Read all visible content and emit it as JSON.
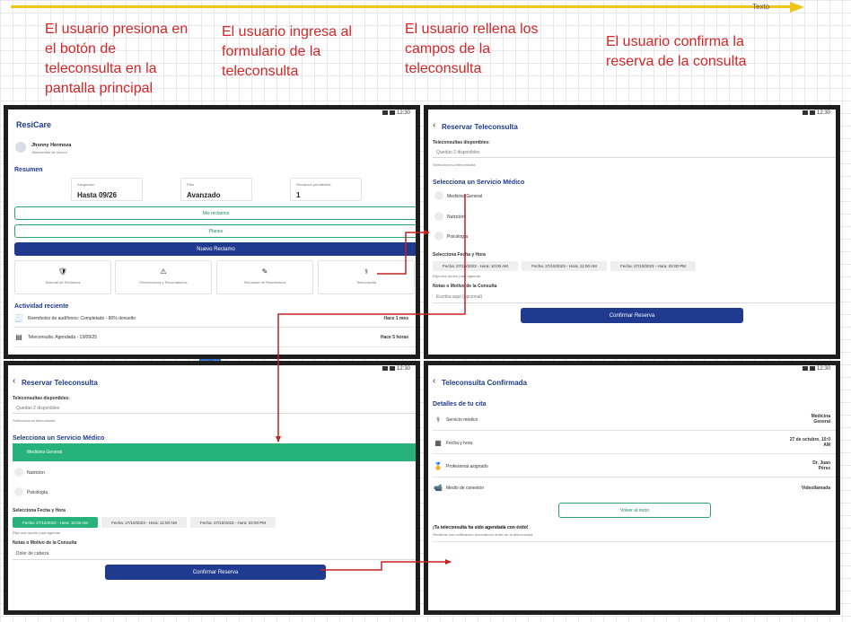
{
  "timeline": {
    "label": "Texto",
    "color": "#f2c31b"
  },
  "steps": [
    "El usuario presiona en el botón de teleconsulta en la pantalla principal",
    "El usuario ingresa al formulario de la teleconsulta",
    "El usuario rellena los campos de la teleconsulta",
    "El usuario confirma la reserva de la consulta"
  ],
  "colors": {
    "step_text": "#d32626",
    "arrow": "#c62121",
    "primary": "#1f3a8f",
    "accent": "#26b27a",
    "frame": "#1e1e1e"
  },
  "status_time": "12:30",
  "screen1": {
    "app_title": "ResiCare",
    "user_name": "Jhonny Hermoza",
    "user_subtitle": "¡Bienvenido de nuevo!",
    "summary_title": "Resumen",
    "cards": [
      {
        "label": "Asegurado",
        "value": "Hasta 09/26"
      },
      {
        "label": "Plan",
        "value": "Avanzado"
      },
      {
        "label": "Reclamos pendientes",
        "value": "1"
      }
    ],
    "my_claims_button": "Mis reclamos",
    "plans_button": "Planes",
    "new_claim_button": "Nuevo Reclamo",
    "actions": [
      {
        "icon": "history-icon",
        "label": "Historial de Reclamos"
      },
      {
        "icon": "warning-icon",
        "label": "Prevenciones y Recordatorios"
      },
      {
        "icon": "pencil-icon",
        "label": "Simulador de Reembolsos"
      },
      {
        "icon": "stethoscope-icon",
        "label": "Teleconsulta"
      }
    ],
    "activity_title": "Actividad reciente",
    "activities": [
      {
        "icon": "receipt-icon",
        "text": "Reembolso de audífonos: Completado - 80% devuelto",
        "time": "Hace 1 mes"
      },
      {
        "icon": "calendar-icon",
        "text": "Teleconsulta: Agendada - 19/09/25",
        "time": "Hace 5 horas"
      }
    ],
    "size_badge": "1162 × 702"
  },
  "form": {
    "title": "Reservar Teleconsulta",
    "available_label": "Teleconsultas disponibles:",
    "available_value": "Quedan 2 disponibles",
    "available_hint": "Selecciona su teleconsulta",
    "service_title": "Selecciona un Servicio Médico",
    "services": [
      "Medicina General",
      "Nutrición",
      "Psicología"
    ],
    "datetime_label": "Selecciona Fecha y Hora",
    "slots": [
      "Fecha: 27/10/2023 - Hora: 10:00 AM",
      "Fecha: 27/10/2023 - Hora: 11:00 AM",
      "Fecha: 27/10/2023 - Hora: 02:00 PM"
    ],
    "slot_hint": "Elija una opción para agendar",
    "notes_label": "Notas o Motivo de la Consulta",
    "notes_placeholder": "Escriba aquí (opcional)",
    "notes_value_filled": "Dolor de cabeza",
    "confirm_button": "Confirmar Reserva"
  },
  "confirmed": {
    "title": "Teleconsulta Confirmada",
    "details_title": "Detalles de tu cita",
    "rows": [
      {
        "icon": "service-icon",
        "label": "Servicio médico",
        "value": "Medicina General"
      },
      {
        "icon": "calendar-icon",
        "label": "Fecha y hora",
        "value": "27 de octubre, 10:0 AM"
      },
      {
        "icon": "doctor-icon",
        "label": "Profesional asignado",
        "value": "Dr. Juan Pérez"
      },
      {
        "icon": "video-icon",
        "label": "Medio de conexión",
        "value": "Videollamada"
      }
    ],
    "home_button": "Volver al inicio",
    "success_title": "¡Tu teleconsulta ha sido agendada con éxito!",
    "success_text": "Recibirás una notificación recordatorio antes de la teleconsulta."
  }
}
